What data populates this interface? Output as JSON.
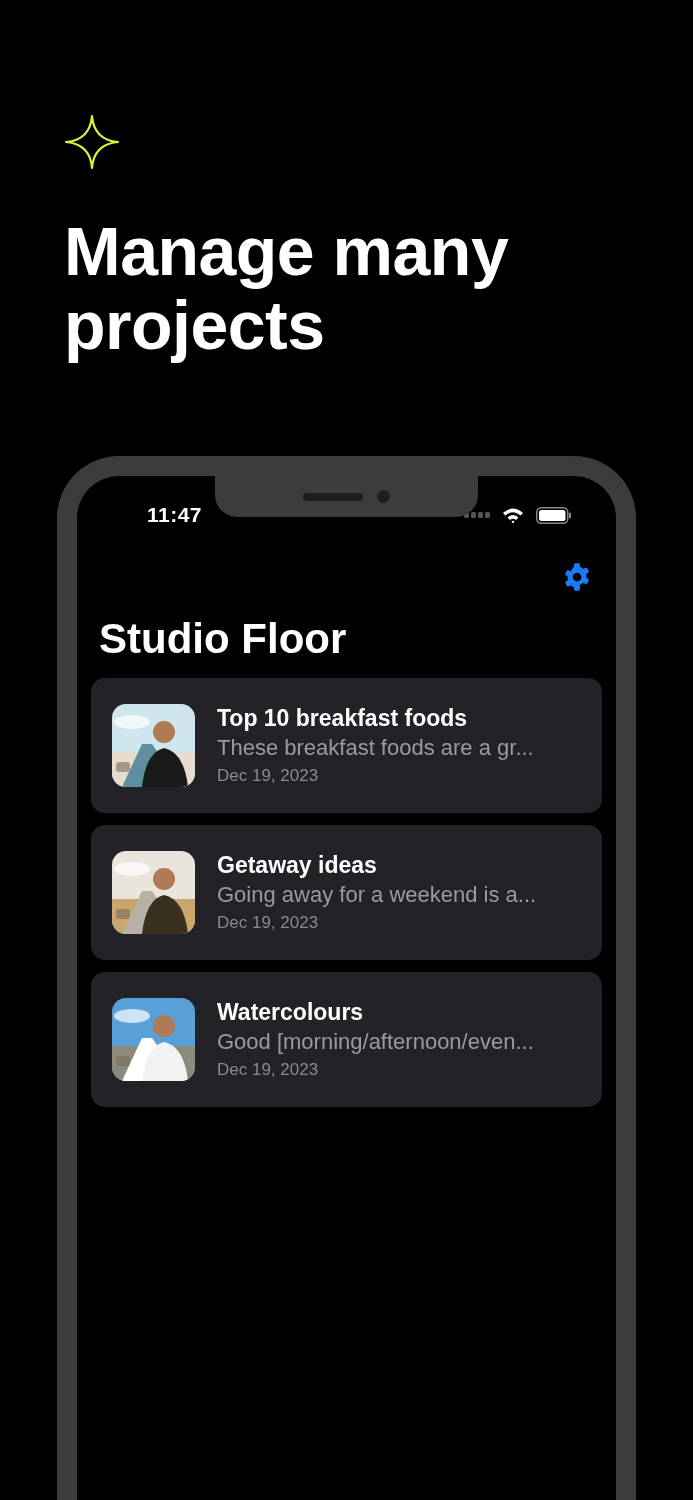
{
  "headline": "Manage many projects",
  "status_bar": {
    "time": "11:47"
  },
  "app": {
    "title": "Studio Floor",
    "projects": [
      {
        "title": "Top 10 breakfast foods",
        "excerpt": "These breakfast foods are a gr...",
        "date": "Dec 19, 2023"
      },
      {
        "title": "Getaway ideas",
        "excerpt": "Going away for a weekend is a...",
        "date": "Dec 19, 2023"
      },
      {
        "title": "Watercolours",
        "excerpt": "Good [morning/afternoon/even...",
        "date": "Dec 19, 2023"
      }
    ]
  }
}
